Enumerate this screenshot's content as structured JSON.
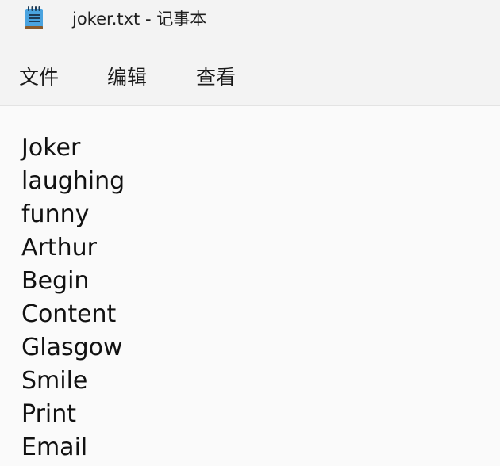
{
  "window": {
    "title": "joker.txt - 记事本",
    "icon": "notepad-icon"
  },
  "menu": {
    "file": "文件",
    "edit": "编辑",
    "view": "查看"
  },
  "document": {
    "lines": [
      "Joker",
      "laughing",
      "funny",
      "Arthur",
      "Begin",
      "Content",
      "Glasgow",
      "Smile",
      "Print",
      "Email"
    ]
  },
  "colors": {
    "background": "#f3f3f3",
    "editor_background": "#fafafa",
    "text": "#111111",
    "icon_blue": "#4aa3df",
    "icon_brown": "#8a5a2b"
  }
}
